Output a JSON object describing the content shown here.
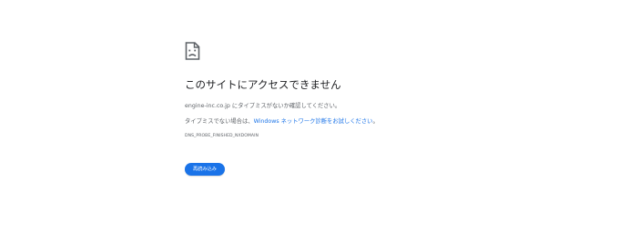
{
  "error": {
    "icon": "sad-page-icon",
    "title": "このサイトにアクセスできません",
    "detail": "engine-inc.co.jp にタイプミスがないか確認してください。",
    "suggestion_prefix": "タイプミスでない場合は、",
    "suggestion_link": "Windows ネットワーク診断をお試しください",
    "suggestion_suffix": "。",
    "code": "DNS_PROBE_FINISHED_NXDOMAIN"
  },
  "actions": {
    "reload_label": "再読み込み"
  },
  "colors": {
    "accent": "#1a73e8",
    "title_text": "#202124",
    "secondary_text": "#5f6368",
    "background": "#ffffff"
  }
}
